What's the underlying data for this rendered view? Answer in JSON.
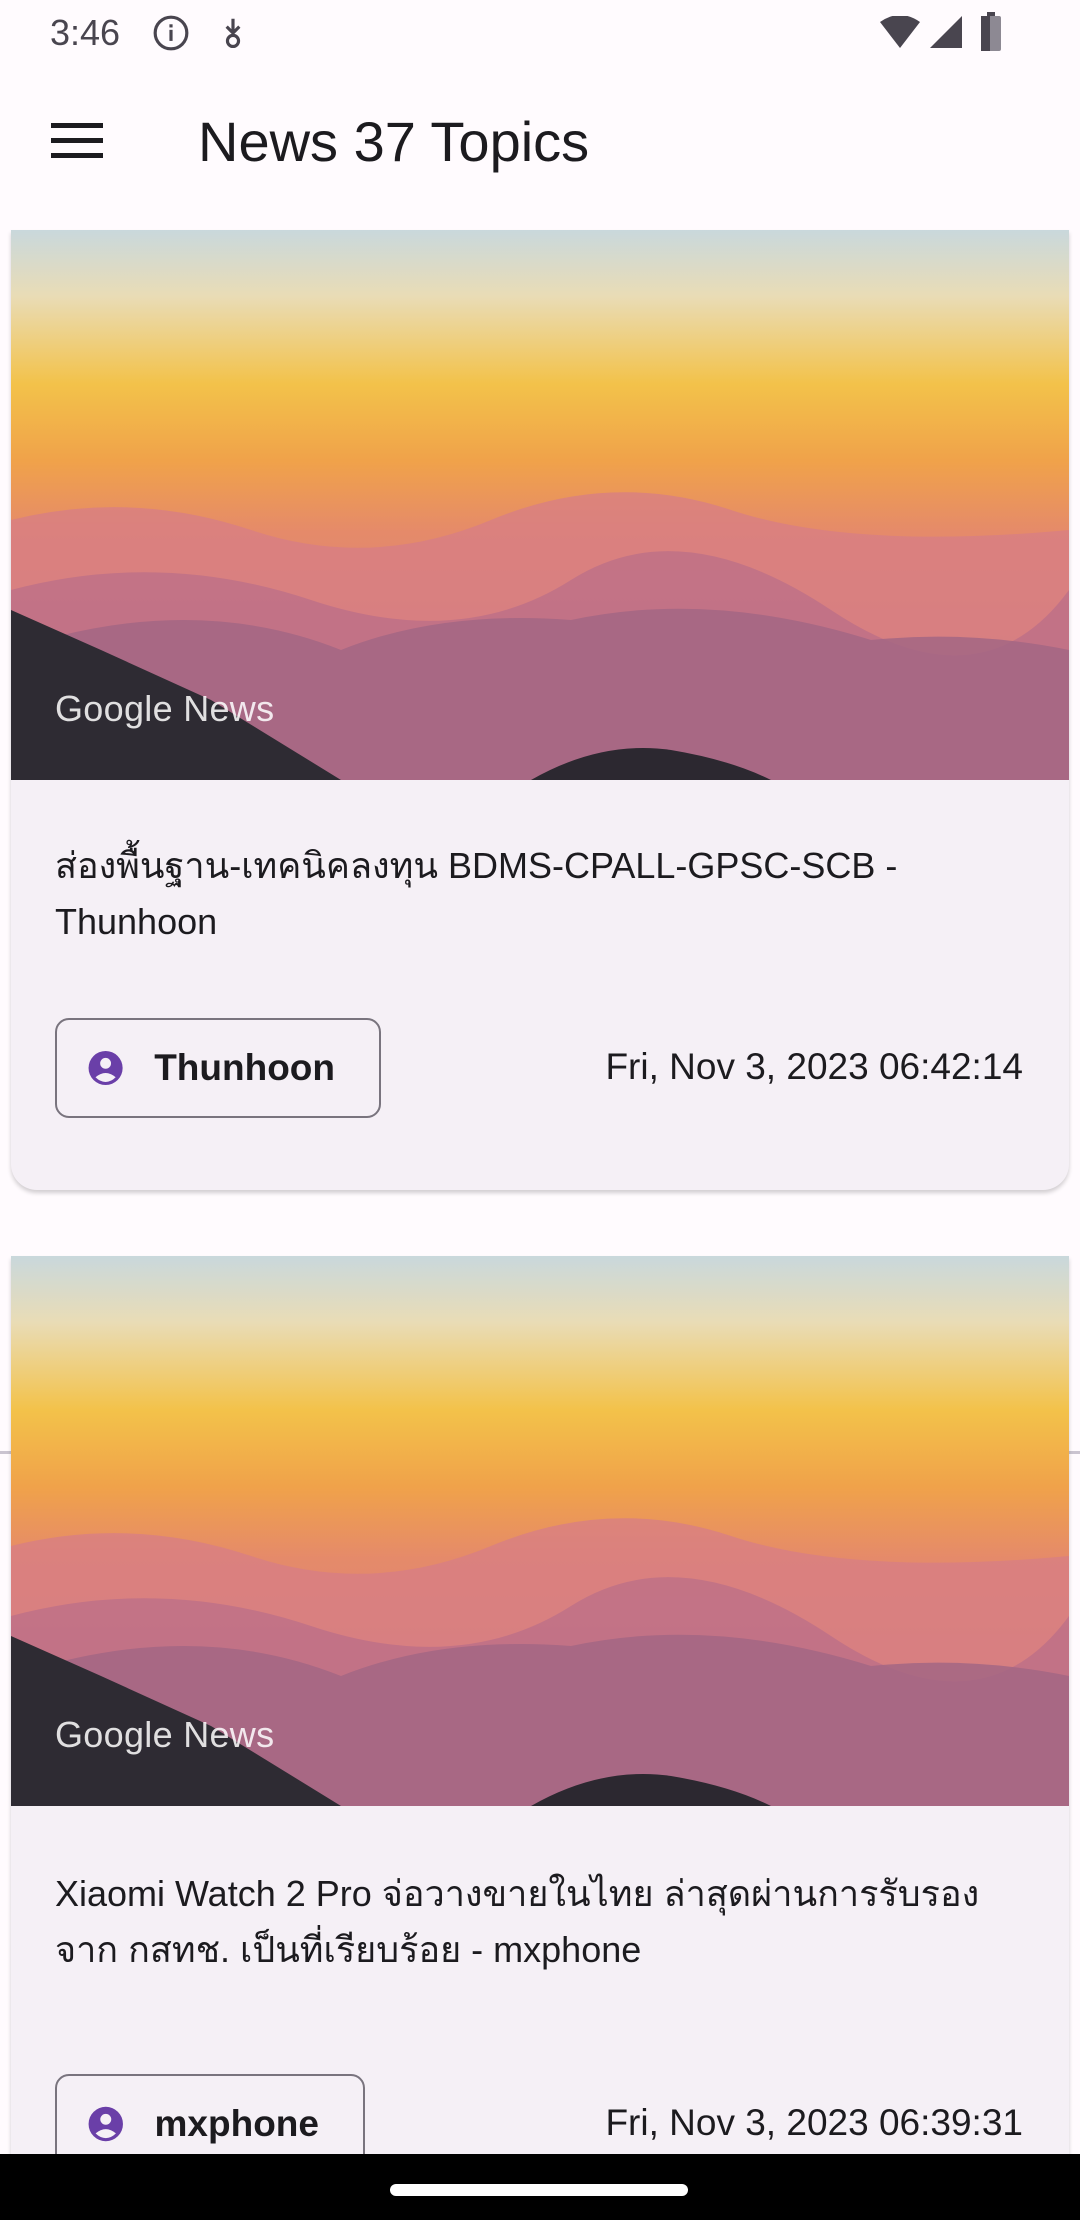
{
  "status_bar": {
    "time": "3:46",
    "icons": [
      "info-icon",
      "data-saver-icon",
      "wifi-icon",
      "cell-signal-icon",
      "battery-icon"
    ]
  },
  "app_bar": {
    "menu_icon": "hamburger-menu-icon",
    "title": "News 37 Topics"
  },
  "articles": [
    {
      "image_source": "Google News",
      "title": "ส่องพื้นฐาน-เทคนิคลงทุน BDMS-CPALL-GPSC-SCB - Thunhoon",
      "author": "Thunhoon",
      "author_icon": "account-circle-icon",
      "date": "Fri, Nov 3, 2023 06:42:14"
    },
    {
      "image_source": "Google News",
      "title": "Xiaomi Watch 2 Pro จ่อวางขายในไทย ล่าสุดผ่านการรับรองจาก กสทช. เป็นที่เรียบร้อย - mxphone",
      "author": "mxphone",
      "author_icon": "account-circle-icon",
      "date": "Fri, Nov 3, 2023 06:39:31"
    }
  ],
  "colors": {
    "background": "#fffbfe",
    "card_background": "#f5f0f6",
    "chip_icon": "#6a3fa8",
    "chip_border": "#79747e"
  }
}
